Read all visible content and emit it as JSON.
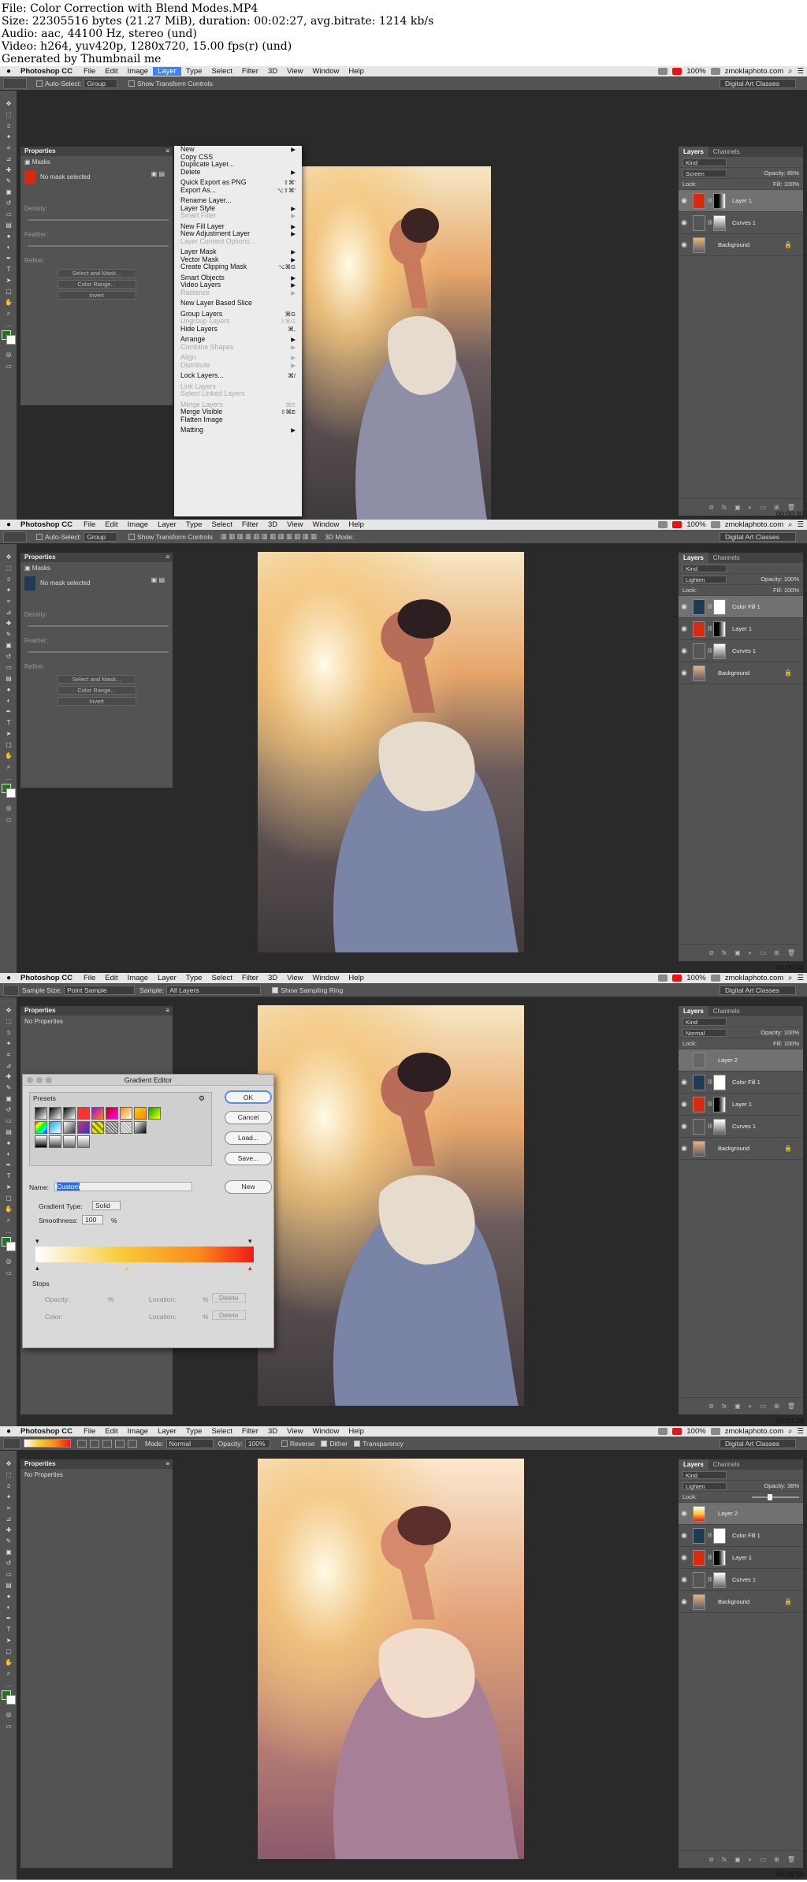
{
  "info": {
    "line1": "File: Color Correction with Blend Modes.MP4",
    "line2": "Size: 22305516 bytes (21.27 MiB), duration: 00:02:27, avg.bitrate: 1214 kb/s",
    "line3": "Audio: aac, 44100 Hz, stereo (und)",
    "line4": "Video: h264, yuv420p, 1280x720, 15.00 fps(r) (und)",
    "line5": "Generated by Thumbnail me"
  },
  "menubar": {
    "apple": "",
    "app": "Photoshop CC",
    "items": [
      "File",
      "Edit",
      "Image",
      "Layer",
      "Type",
      "Select",
      "Filter",
      "3D",
      "View",
      "Window",
      "Help"
    ],
    "zoom": "100%",
    "site": "zmoklaphoto.com"
  },
  "options": {
    "auto_select": "Auto-Select:",
    "group": "Group",
    "show_transform": "Show Transform Controls",
    "mode_3d": "3D Mode:",
    "workspace": "Digital Art Classes",
    "sample_size_lbl": "Sample Size:",
    "sample_size": "Point Sample",
    "sample_lbl": "Sample:",
    "sample": "All Layers",
    "show_ring": "Show Sampling Ring",
    "mode_lbl": "Mode:",
    "mode": "Normal",
    "opacity_lbl": "Opacity:",
    "opacity": "100%",
    "reverse": "Reverse",
    "dither": "Dither",
    "transparency": "Transparency"
  },
  "properties": {
    "title": "Properties",
    "masks": "Masks",
    "no_mask": "No mask selected",
    "density": "Density:",
    "feather": "Feather:",
    "refine": "Refine:",
    "select_mask": "Select and Mask...",
    "color_range": "Color Range...",
    "invert": "Invert",
    "no_properties": "No Properties"
  },
  "layers": {
    "tab_layers": "Layers",
    "tab_channels": "Channels",
    "kind": "Kind",
    "lock": "Lock:",
    "opacity_lbl": "Opacity:",
    "fill_lbl": "Fill:",
    "fill": "100%",
    "f1": {
      "blend": "Screen",
      "opacity": "85%",
      "items": [
        "Layer 1",
        "Curves 1",
        "Background"
      ]
    },
    "f2": {
      "blend": "Lighten",
      "opacity": "100%",
      "items": [
        "Color Fill 1",
        "Layer 1",
        "Curves 1",
        "Background"
      ]
    },
    "f3": {
      "blend": "Normal",
      "opacity": "100%",
      "items": [
        "Layer 2",
        "Color Fill 1",
        "Layer 1",
        "Curves 1",
        "Background"
      ]
    },
    "f4": {
      "blend": "Lighten",
      "opacity": "38%",
      "items": [
        "Layer 2",
        "Color Fill 1",
        "Layer 1",
        "Curves 1",
        "Background"
      ]
    }
  },
  "layer_menu": [
    {
      "label": "New",
      "sub": true
    },
    {
      "label": "Copy CSS"
    },
    {
      "label": "Duplicate Layer..."
    },
    {
      "label": "Delete",
      "sub": true
    },
    {
      "sep": true
    },
    {
      "label": "Quick Export as PNG",
      "sc": "⇧⌘'"
    },
    {
      "label": "Export As...",
      "sc": "⌥⇧⌘'"
    },
    {
      "sep": true
    },
    {
      "label": "Rename Layer..."
    },
    {
      "label": "Layer Style",
      "sub": true
    },
    {
      "label": "Smart Filter",
      "dis": true,
      "sub": true
    },
    {
      "sep": true
    },
    {
      "label": "New Fill Layer",
      "sub": true
    },
    {
      "label": "New Adjustment Layer",
      "sub": true
    },
    {
      "label": "Layer Content Options...",
      "dis": true
    },
    {
      "sep": true
    },
    {
      "label": "Layer Mask",
      "sub": true
    },
    {
      "label": "Vector Mask",
      "sub": true
    },
    {
      "label": "Create Clipping Mask",
      "sc": "⌥⌘G"
    },
    {
      "sep": true
    },
    {
      "label": "Smart Objects",
      "sub": true
    },
    {
      "label": "Video Layers",
      "sub": true
    },
    {
      "label": "Rasterize",
      "dis": true,
      "sub": true
    },
    {
      "sep": true
    },
    {
      "label": "New Layer Based Slice"
    },
    {
      "sep": true
    },
    {
      "label": "Group Layers",
      "sc": "⌘G"
    },
    {
      "label": "Ungroup Layers",
      "dis": true,
      "sc": "⇧⌘G"
    },
    {
      "label": "Hide Layers",
      "sc": "⌘,"
    },
    {
      "sep": true
    },
    {
      "label": "Arrange",
      "sub": true
    },
    {
      "label": "Combine Shapes",
      "dis": true,
      "sub": true
    },
    {
      "sep": true
    },
    {
      "label": "Align",
      "dis": true,
      "sub": true
    },
    {
      "label": "Distribute",
      "dis": true,
      "sub": true
    },
    {
      "sep": true
    },
    {
      "label": "Lock Layers...",
      "sc": "⌘/"
    },
    {
      "sep": true
    },
    {
      "label": "Link Layers",
      "dis": true
    },
    {
      "label": "Select Linked Layers",
      "dis": true
    },
    {
      "sep": true
    },
    {
      "label": "Merge Layers",
      "dis": true,
      "sc": "⌘E"
    },
    {
      "label": "Merge Visible",
      "sc": "⇧⌘E"
    },
    {
      "label": "Flatten Image"
    },
    {
      "sep": true
    },
    {
      "label": "Matting",
      "sub": true
    }
  ],
  "gradient_editor": {
    "title": "Gradient Editor",
    "presets": "Presets",
    "ok": "OK",
    "cancel": "Cancel",
    "load": "Load...",
    "save": "Save...",
    "name_lbl": "Name:",
    "name": "Custom",
    "new": "New",
    "type_lbl": "Gradient Type:",
    "type": "Solid",
    "smooth_lbl": "Smoothness:",
    "smooth": "100",
    "pct": "%",
    "stops": "Stops",
    "opacity": "Opacity:",
    "color": "Color:",
    "location": "Location:",
    "delete": "Delete"
  },
  "timestamps": [
    "00:00:30",
    "00:00:58",
    "00:01:28",
    "00:01:56"
  ]
}
